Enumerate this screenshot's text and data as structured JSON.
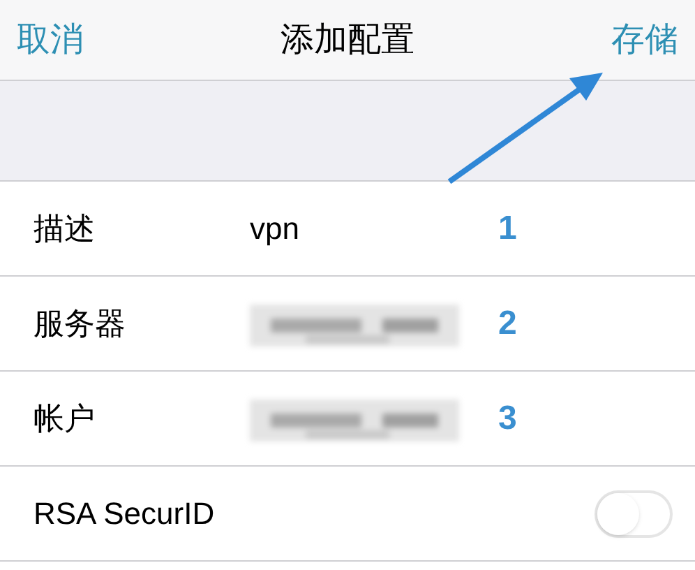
{
  "nav": {
    "cancel": "取消",
    "title": "添加配置",
    "save": "存储"
  },
  "rows": [
    {
      "label": "描述",
      "kind": "text",
      "value": "vpn",
      "annotation": "1"
    },
    {
      "label": "服务器",
      "kind": "redacted",
      "annotation": "2"
    },
    {
      "label": "帐户",
      "kind": "redacted",
      "annotation": "3"
    },
    {
      "label": "RSA SecurID",
      "kind": "switch",
      "on": false
    }
  ]
}
